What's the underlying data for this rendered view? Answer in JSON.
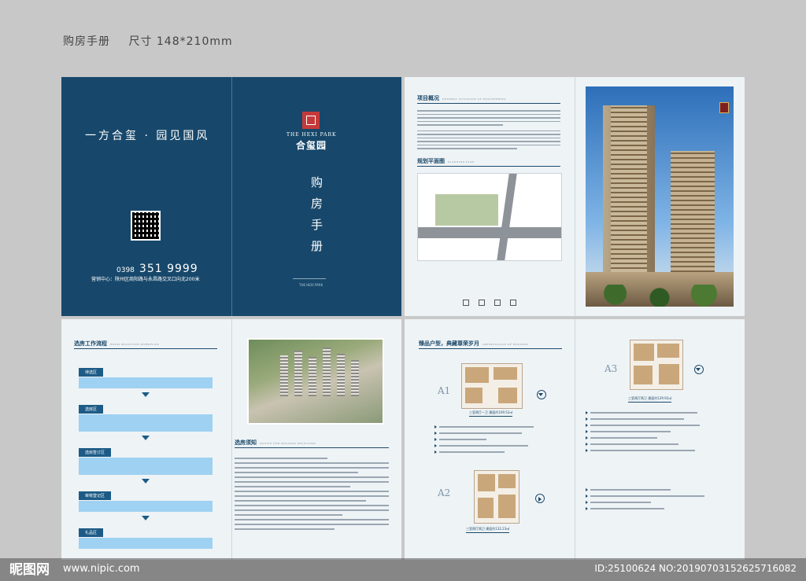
{
  "caption": {
    "title": "购房手册",
    "size": "尺寸 148*210mm"
  },
  "cover": {
    "slogan": "一方合玺 · 园见国风",
    "tel_prefix": "0398",
    "tel_number": "351 9999",
    "address": "营销中心：陕州区商阳路与永昌路交叉口向北200米",
    "logo_en": "THE HEXI PARK",
    "logo_cn": "合玺园",
    "title": "购房手册",
    "back_en": "THE HEXI PARK"
  },
  "spread1": {
    "overview_title": "项目概况",
    "overview_en": "GENERAL SITUATION OF ENGINEERING",
    "plan_title": "规划平面图",
    "plan_en": "PLANNING PLAN"
  },
  "spread2": {
    "workflow_title": "选房工作流程",
    "workflow_en": "ROOM SELECTION WORKFLOW",
    "steps": [
      "待选区",
      "选房区",
      "选房签订区",
      "审核登记区",
      "礼品区"
    ],
    "notice_title": "选房须知",
    "notice_en": "NOTICE FOR HOUSING SELECTION"
  },
  "spread3": {
    "title": "臻品户型，典藏尊荣岁月",
    "title_en": "APPRECIATION OF HOUSING",
    "units": [
      {
        "name": "A1",
        "caption": "三室两厅一卫 建面约109.52㎡"
      },
      {
        "name": "A3",
        "caption": "三室两厅两卫 建面约129.92㎡"
      },
      {
        "name": "A2",
        "caption": "三室两厅两卫 建面约132.23㎡"
      }
    ]
  },
  "watermark": {
    "logo": "昵图网",
    "url": "www.nipic.com",
    "id": "ID:25100624 NO:20190703152625716082"
  }
}
